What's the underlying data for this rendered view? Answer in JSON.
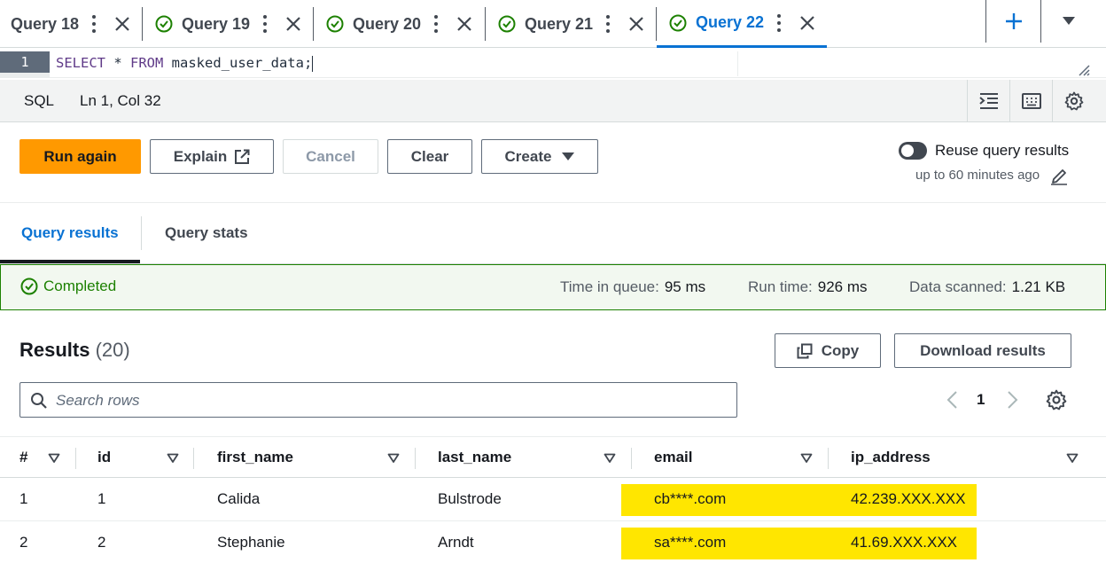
{
  "tabs": [
    {
      "label": "Query 18",
      "completed": false,
      "active": false
    },
    {
      "label": "Query 19",
      "completed": true,
      "active": false
    },
    {
      "label": "Query 20",
      "completed": true,
      "active": false
    },
    {
      "label": "Query 21",
      "completed": true,
      "active": false
    },
    {
      "label": "Query 22",
      "completed": true,
      "active": true
    }
  ],
  "editor": {
    "line_number": "1",
    "code_kw1": "SELECT",
    "code_mid": " * ",
    "code_kw2": "FROM",
    "code_rest": " masked_user_data;"
  },
  "statusbar": {
    "language": "SQL",
    "position": "Ln 1, Col 32"
  },
  "actions": {
    "run_again": "Run again",
    "explain": "Explain",
    "cancel": "Cancel",
    "clear": "Clear",
    "create": "Create",
    "reuse_label": "Reuse query results",
    "reuse_sub": "up to 60 minutes ago",
    "reuse_enabled": false
  },
  "result_tabs": {
    "results": "Query results",
    "stats": "Query stats"
  },
  "banner": {
    "status": "Completed",
    "queue_label": "Time in queue:",
    "queue_value": "95 ms",
    "runtime_label": "Run time:",
    "runtime_value": "926 ms",
    "scanned_label": "Data scanned:",
    "scanned_value": "1.21 KB"
  },
  "results": {
    "title": "Results",
    "count": "(20)",
    "copy": "Copy",
    "download": "Download results",
    "search_placeholder": "Search rows",
    "page": "1"
  },
  "table": {
    "columns": [
      "#",
      "id",
      "first_name",
      "last_name",
      "email",
      "ip_address"
    ],
    "rows": [
      [
        "1",
        "1",
        "Calida",
        "Bulstrode",
        "cb****.com",
        "42.239.XXX.XXX"
      ],
      [
        "2",
        "2",
        "Stephanie",
        "Arndt",
        "sa****.com",
        "41.69.XXX.XXX"
      ]
    ]
  },
  "colors": {
    "accent": "#0972d3",
    "primary_button": "#ff9900",
    "success": "#1d8102",
    "highlight": "#ffe600"
  }
}
